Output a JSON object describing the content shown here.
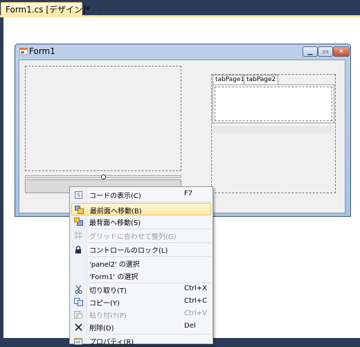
{
  "document_tab": {
    "title": "Form1.cs [デザイン]*",
    "close_glyph": "✕"
  },
  "form": {
    "title": "Form1",
    "min_glyph": "▁",
    "max_glyph": "▭",
    "close_glyph": "✕"
  },
  "tab_control": {
    "tabs": [
      "tabPage1",
      "tabPage2"
    ]
  },
  "context_menu": {
    "items": [
      {
        "label": "コードの表示(C)",
        "shortcut": "F7",
        "icon": "view-code-icon",
        "disabled": false,
        "highlighted": false
      },
      {
        "label": "最前面へ移動(B)",
        "shortcut": "",
        "icon": "bring-to-front-icon",
        "disabled": false,
        "highlighted": true
      },
      {
        "label": "最背面へ移動(S)",
        "shortcut": "",
        "icon": "send-to-back-icon",
        "disabled": false,
        "highlighted": false
      },
      {
        "label": "グリッドに合わせて整列(G)",
        "shortcut": "",
        "icon": "align-to-grid-icon",
        "disabled": true,
        "highlighted": false
      },
      {
        "label": "コントロールのロック(L)",
        "shortcut": "",
        "icon": "lock-icon",
        "disabled": false,
        "highlighted": false
      },
      {
        "label": "'panel2' の選択",
        "shortcut": "",
        "icon": "",
        "disabled": false,
        "highlighted": false
      },
      {
        "label": "'Form1' の選択",
        "shortcut": "",
        "icon": "",
        "disabled": false,
        "highlighted": false
      },
      {
        "label": "切り取り(T)",
        "shortcut": "Ctrl+X",
        "icon": "cut-icon",
        "disabled": false,
        "highlighted": false
      },
      {
        "label": "コピー(Y)",
        "shortcut": "Ctrl+C",
        "icon": "copy-icon",
        "disabled": false,
        "highlighted": false
      },
      {
        "label": "貼り付け(P)",
        "shortcut": "Ctrl+V",
        "icon": "paste-icon",
        "disabled": true,
        "highlighted": false
      },
      {
        "label": "削除(D)",
        "shortcut": "Del",
        "icon": "delete-icon",
        "disabled": false,
        "highlighted": false
      },
      {
        "label": "プロパティ(R)",
        "shortcut": "",
        "icon": "properties-icon",
        "disabled": false,
        "highlighted": false
      }
    ]
  },
  "colors": {
    "ide_background": "#2b3c59",
    "active_tab": "#ffe8a6",
    "highlight": "#ffe9a8"
  }
}
